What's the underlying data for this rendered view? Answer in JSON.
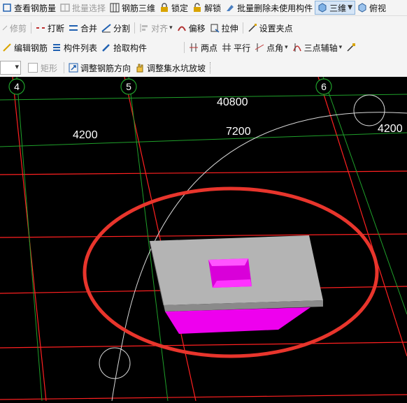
{
  "toolbar1": {
    "view_rebar": "查看钢筋量",
    "batch_select": "批量选择",
    "rebar_3d": "钢筋三维",
    "lock": "锁定",
    "unlock": "解锁",
    "batch_delete_unused": "批量删除未使用构件",
    "view_3d": "三维",
    "top_view": "俯视"
  },
  "toolbar2": {
    "trim": "修剪",
    "break": "打断",
    "merge": "合并",
    "split": "分割",
    "align": "对齐",
    "offset": "偏移",
    "stretch": "拉伸",
    "set_grip": "设置夹点"
  },
  "toolbar3": {
    "edit_rebar": "编辑钢筋",
    "component_list": "构件列表",
    "pick_component": "拾取构件",
    "two_points": "两点",
    "parallel": "平行",
    "point_angle": "点角",
    "three_point_aux": "三点辅轴",
    "more": ""
  },
  "toolbar4": {
    "rectangle": "矩形",
    "adjust_rebar_direction": "调整钢筋方向",
    "adjust_sump_slope": "调整集水坑放坡"
  },
  "viewport": {
    "background": "#000000",
    "axis_labels": [
      "4",
      "5",
      "6"
    ],
    "dimensions": {
      "total": "40800",
      "span_4_5": "4200",
      "span_5_6": "7200",
      "span_right": "4200"
    },
    "colors": {
      "grid_red": "#ff2020",
      "axis_green": "#1fa02a",
      "highlight_ellipse": "#e8352c",
      "slab": "#b4b4b4",
      "sump_pit": "#ee00ee"
    }
  }
}
